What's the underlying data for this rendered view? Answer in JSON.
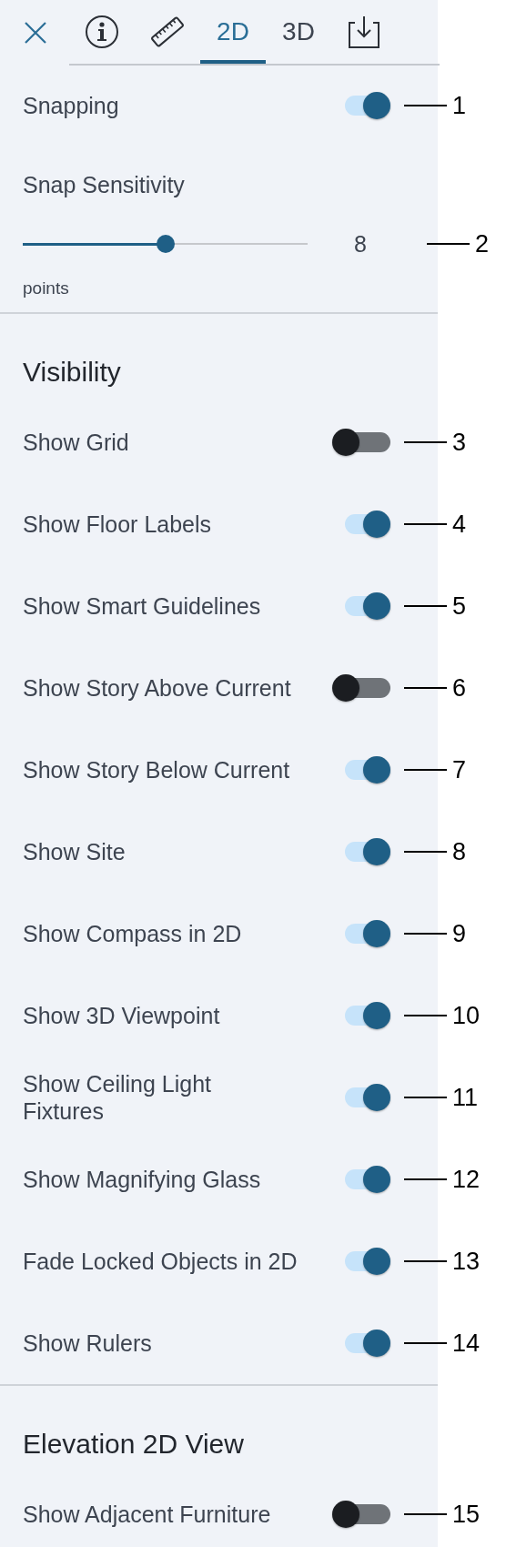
{
  "tabs": [
    {
      "kind": "info",
      "selected": false
    },
    {
      "kind": "ruler",
      "selected": false
    },
    {
      "kind": "text",
      "label": "2D",
      "selected": true
    },
    {
      "kind": "text",
      "label": "3D",
      "selected": false
    },
    {
      "kind": "download",
      "selected": false
    }
  ],
  "snapping": {
    "label": "Snapping",
    "on": true,
    "callout": "1"
  },
  "snap_sensitivity": {
    "label": "Snap Sensitivity",
    "level": 0.5,
    "value": "8",
    "unit": "points",
    "callout": "2"
  },
  "sections": [
    {
      "title": "Visibility",
      "items": [
        {
          "label": "Show Grid",
          "on": false,
          "callout": "3"
        },
        {
          "label": "Show Floor Labels",
          "on": true,
          "callout": "4"
        },
        {
          "label": "Show Smart Guidelines",
          "on": true,
          "callout": "5"
        },
        {
          "label": "Show Story Above Current",
          "on": false,
          "callout": "6"
        },
        {
          "label": "Show Story Below Current",
          "on": true,
          "callout": "7"
        },
        {
          "label": "Show Site",
          "on": true,
          "callout": "8"
        },
        {
          "label": "Show Compass in 2D",
          "on": true,
          "callout": "9"
        },
        {
          "label": "Show 3D Viewpoint",
          "on": true,
          "callout": "10"
        },
        {
          "label": "Show Ceiling Light\nFixtures",
          "on": true,
          "callout": "11"
        },
        {
          "label": "Show Magnifying Glass",
          "on": true,
          "callout": "12"
        },
        {
          "label": "Fade Locked Objects in 2D",
          "on": true,
          "callout": "13"
        },
        {
          "label": "Show Rulers",
          "on": true,
          "callout": "14"
        }
      ]
    },
    {
      "title": "Elevation 2D View",
      "items": [
        {
          "label": "Show Adjacent Furniture",
          "on": false,
          "callout": "15"
        }
      ]
    }
  ]
}
